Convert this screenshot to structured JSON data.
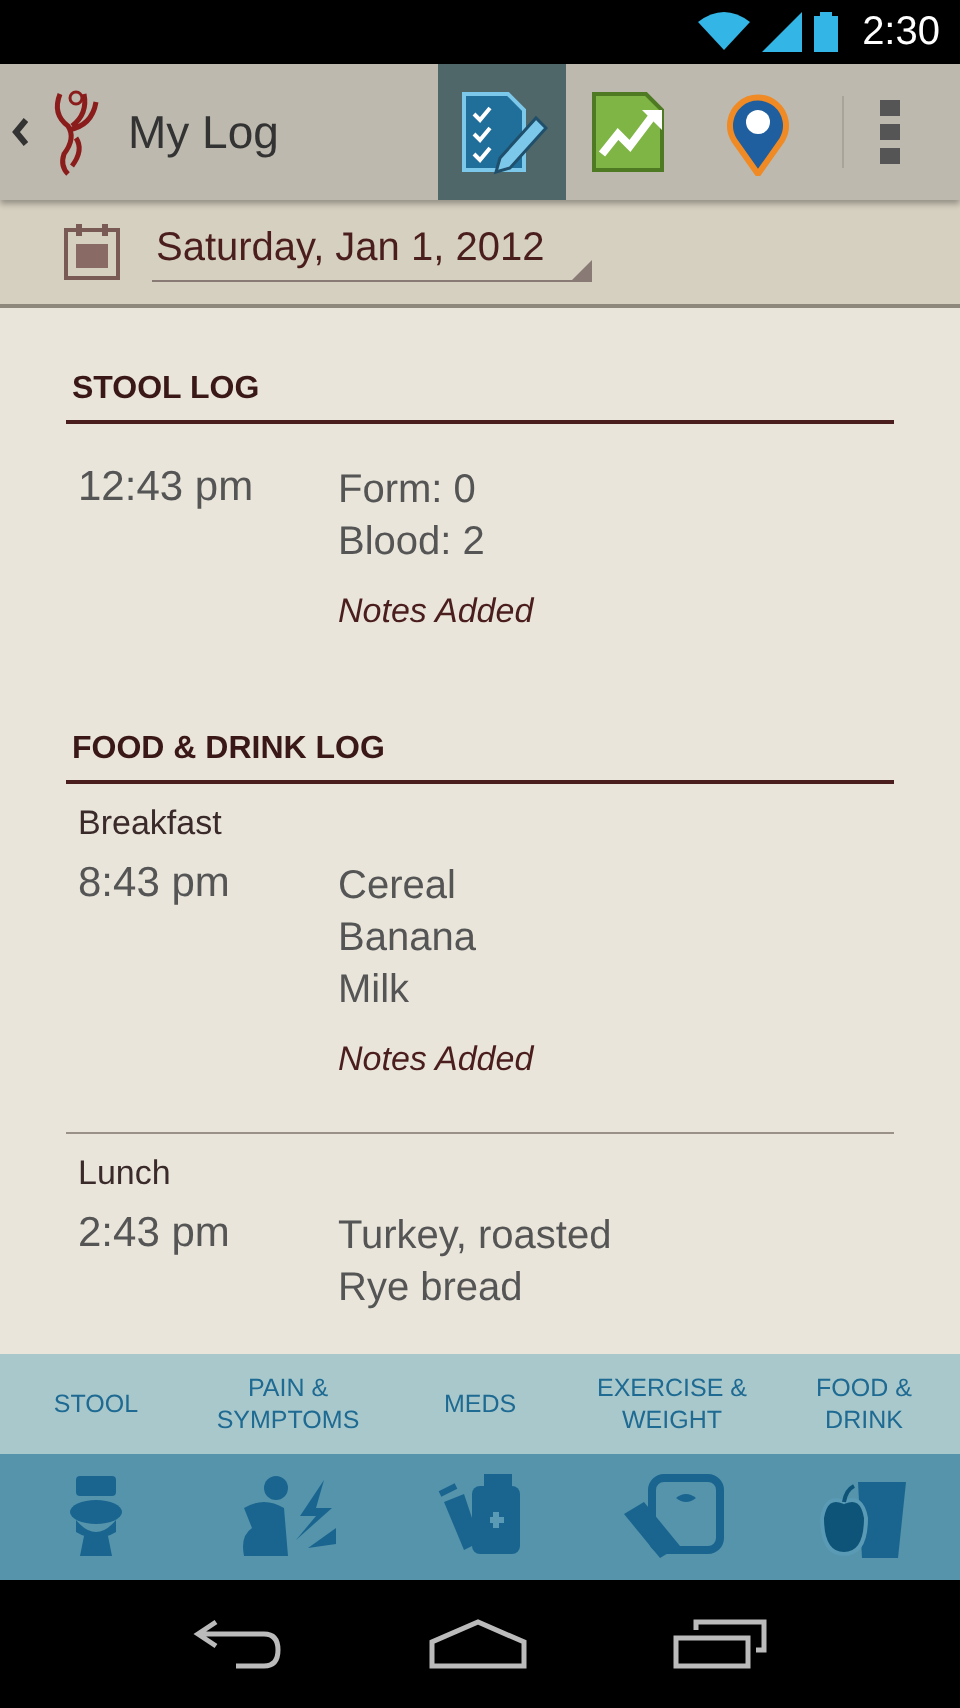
{
  "status_bar": {
    "time": "2:30"
  },
  "action_bar": {
    "title": "My Log",
    "tabs": [
      {
        "kind": "log",
        "selected": true
      },
      {
        "kind": "chart",
        "selected": false
      },
      {
        "kind": "pin",
        "selected": false
      }
    ]
  },
  "date_picker": {
    "value": "Saturday, Jan 1, 2012"
  },
  "sections": [
    {
      "title": "STOOL LOG",
      "entries": [
        {
          "time": "12:43 pm",
          "lines": [
            "Form: 0",
            "Blood: 2"
          ],
          "note": "Notes Added"
        }
      ]
    },
    {
      "title": "FOOD & DRINK LOG",
      "entries": [
        {
          "meal": "Breakfast",
          "time": "8:43 pm",
          "lines": [
            "Cereal",
            "Banana",
            "Milk"
          ],
          "note": "Notes Added"
        },
        {
          "meal": "Lunch",
          "time": "2:43 pm",
          "lines": [
            "Turkey, roasted",
            "Rye bread"
          ]
        }
      ]
    }
  ],
  "categories": [
    {
      "kind": "stool",
      "label": "STOOL"
    },
    {
      "kind": "pain",
      "label": "PAIN & SYMPTOMS"
    },
    {
      "kind": "meds",
      "label": "MEDS"
    },
    {
      "kind": "exercise",
      "label": "EXERCISE & WEIGHT"
    },
    {
      "kind": "food",
      "label": "FOOD & DRINK"
    }
  ]
}
